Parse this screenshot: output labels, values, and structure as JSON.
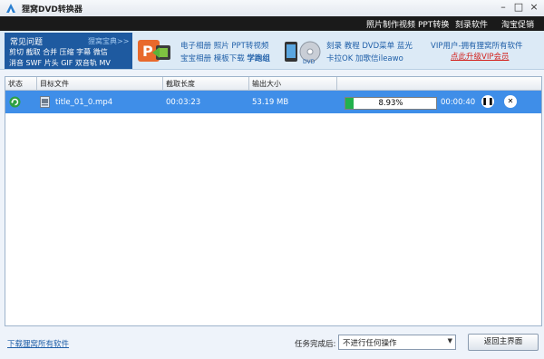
{
  "window": {
    "title": "狸窝DVD转换器",
    "minimize": "–",
    "maximize": "□",
    "close": "×"
  },
  "menu": [
    "照片制作视频",
    "PPT转换",
    "刻录软件",
    "淘宝促销"
  ],
  "banner": {
    "faq_title": "常见问题",
    "faq_more": "狸窝宝典>>",
    "faq_line1": "剪切 截取 合并 压缩 字幕 微信",
    "faq_line2": "消音 SWF 片头 GIF 双音轨 MV",
    "promo1_line1": "电子相册 照片 PPT转视频",
    "promo1_line2a": "宝宝相册 模板下载 ",
    "promo1_line2b": "学跑组",
    "promo2_line1": "刻录 教程 DVD菜单 蓝光",
    "promo2_line2": "卡拉OK 加歌信ileawo",
    "vip_text": "VIP用户-拥有狸窝所有软件",
    "vip_link": "点此升级VIP会员"
  },
  "table": {
    "headers": [
      "状态",
      "目标文件",
      "截取长度",
      "输出大小"
    ],
    "rows": [
      {
        "file": "title_01_0.mp4",
        "length": "00:03:23",
        "size": "53.19 MB",
        "progress_text": "8.93%",
        "progress": 0.0893,
        "remaining": "00:00:40"
      }
    ]
  },
  "footer": {
    "download_link": "下载狸窝所有软件",
    "after_label": "任务完成后:",
    "after_value": "不进行任何操作",
    "back_button": "返回主界面"
  },
  "colors": {
    "menu_bg": "#1a1a1a",
    "selected_row": "#3f8ee8",
    "progress": "#22b14c",
    "faq_bg": "#1e5aa0",
    "vip_link": "#d3211d"
  }
}
